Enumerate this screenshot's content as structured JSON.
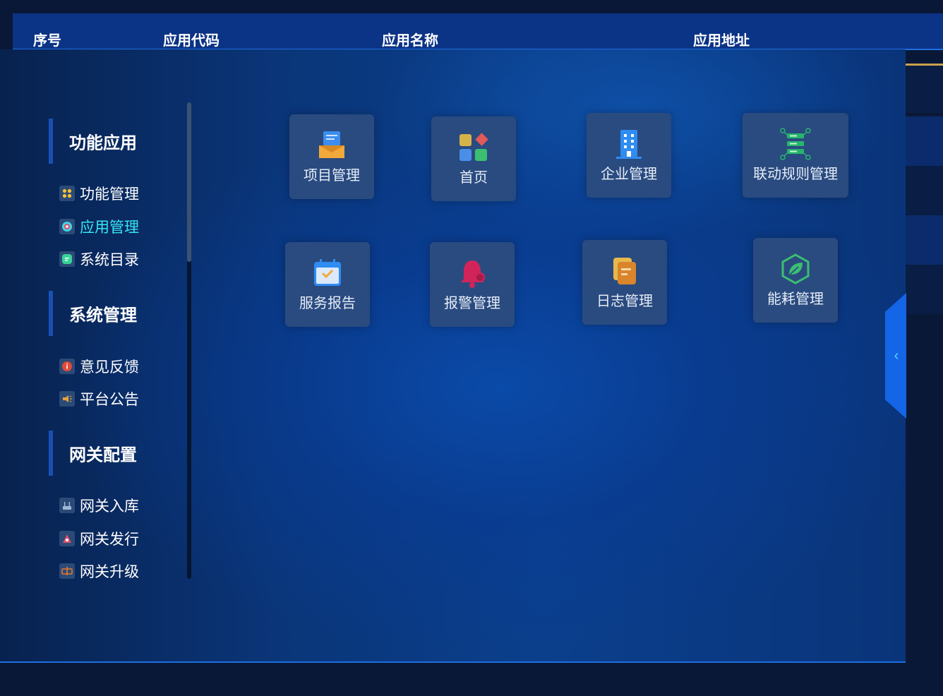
{
  "table_header": {
    "col_index": "序号",
    "col_app_code": "应用代码",
    "col_app_name": "应用名称",
    "col_app_url": "应用地址"
  },
  "sidebar": {
    "sections": [
      {
        "title": "功能应用",
        "items": [
          {
            "label": "功能管理",
            "icon": "dots-grid-icon",
            "active": false
          },
          {
            "label": "应用管理",
            "icon": "app-gear-icon",
            "active": true
          },
          {
            "label": "系统目录",
            "icon": "catalog-icon",
            "active": false
          }
        ]
      },
      {
        "title": "系统管理",
        "items": [
          {
            "label": "意见反馈",
            "icon": "feedback-icon",
            "active": false
          },
          {
            "label": "平台公告",
            "icon": "megaphone-icon",
            "active": false
          }
        ]
      },
      {
        "title": "网关配置",
        "items": [
          {
            "label": "网关入库",
            "icon": "router-icon",
            "active": false
          },
          {
            "label": "网关发行",
            "icon": "publish-icon",
            "active": false
          },
          {
            "label": "网关升级",
            "icon": "upgrade-icon",
            "active": false
          }
        ]
      }
    ]
  },
  "apps": [
    {
      "label": "项目管理",
      "icon": "project-icon"
    },
    {
      "label": "首页",
      "icon": "home-grid-icon"
    },
    {
      "label": "企业管理",
      "icon": "building-icon"
    },
    {
      "label": "联动规则管理",
      "icon": "server-network-icon"
    },
    {
      "label": "服务报告",
      "icon": "calendar-check-icon"
    },
    {
      "label": "报警管理",
      "icon": "alarm-bell-icon"
    },
    {
      "label": "日志管理",
      "icon": "log-files-icon"
    },
    {
      "label": "能耗管理",
      "icon": "leaf-hexagon-icon"
    }
  ],
  "colors": {
    "active_menu": "#36e6f5",
    "accent_blue": "#1466e6",
    "tile_bg": "#2a4b80"
  }
}
